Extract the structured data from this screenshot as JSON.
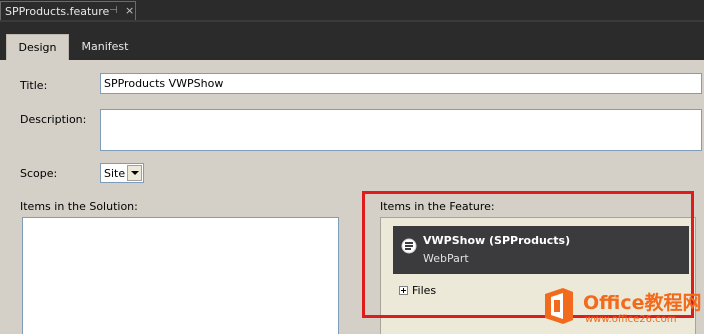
{
  "document": {
    "tab_title": "SPProducts.feature",
    "pin_glyph": "⊣",
    "close_glyph": "×"
  },
  "designer_tabs": [
    {
      "label": "Design",
      "active": true
    },
    {
      "label": "Manifest",
      "active": false
    }
  ],
  "form": {
    "title_label": "Title:",
    "title_value": "SPProducts VWPShow",
    "description_label": "Description:",
    "description_value": "",
    "scope_label": "Scope:",
    "scope_value": "Site",
    "solution_items_label": "Items in the Solution:",
    "feature_items_label": "Items in the Feature:"
  },
  "feature_items": [
    {
      "name": "VWPShow (SPProducts)",
      "type": "WebPart",
      "icon": "webpart-icon"
    }
  ],
  "files": {
    "label": "Files",
    "expander": "plus"
  },
  "watermark": {
    "text": "Office教程网",
    "url": "www.office26.com",
    "color": "#f26a1b"
  },
  "colors": {
    "highlight": "#e01b1b",
    "panel_bg": "#d4d0c8",
    "dark_chrome": "#2b2b2b",
    "item_bg": "#3b3b3d"
  }
}
